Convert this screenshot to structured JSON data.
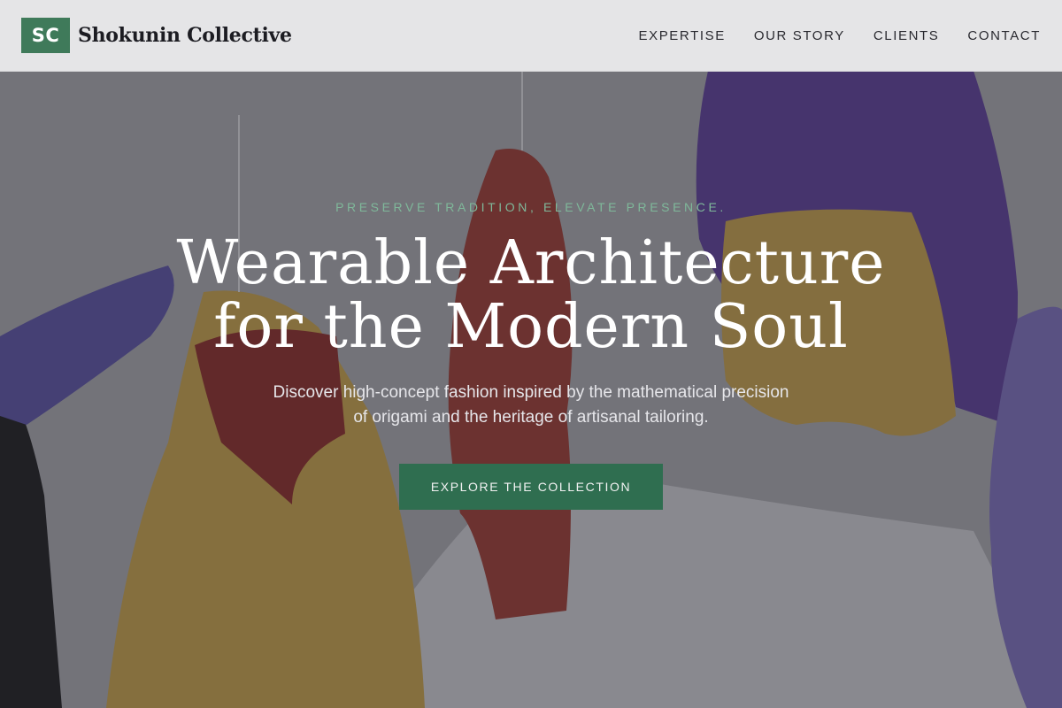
{
  "brand": {
    "logo_initials": "SC",
    "name": "Shokunin Collective",
    "logo_color": "#3f7a5a"
  },
  "nav": {
    "items": [
      {
        "label": "EXPERTISE"
      },
      {
        "label": "OUR STORY"
      },
      {
        "label": "CLIENTS"
      },
      {
        "label": "CONTACT"
      }
    ]
  },
  "hero": {
    "eyebrow": "PRESERVE TRADITION, ELEVATE PRESENCE.",
    "headline_line1": "Wearable Architecture",
    "headline_line2": "for the Modern Soul",
    "subline_line1": "Discover high-concept fashion inspired by the mathematical precision",
    "subline_line2": "of origami and the heritage of artisanal tailoring.",
    "cta_label": "EXPLORE THE COLLECTION",
    "accent_color": "#7fb89a",
    "cta_color": "#2f6e50"
  }
}
